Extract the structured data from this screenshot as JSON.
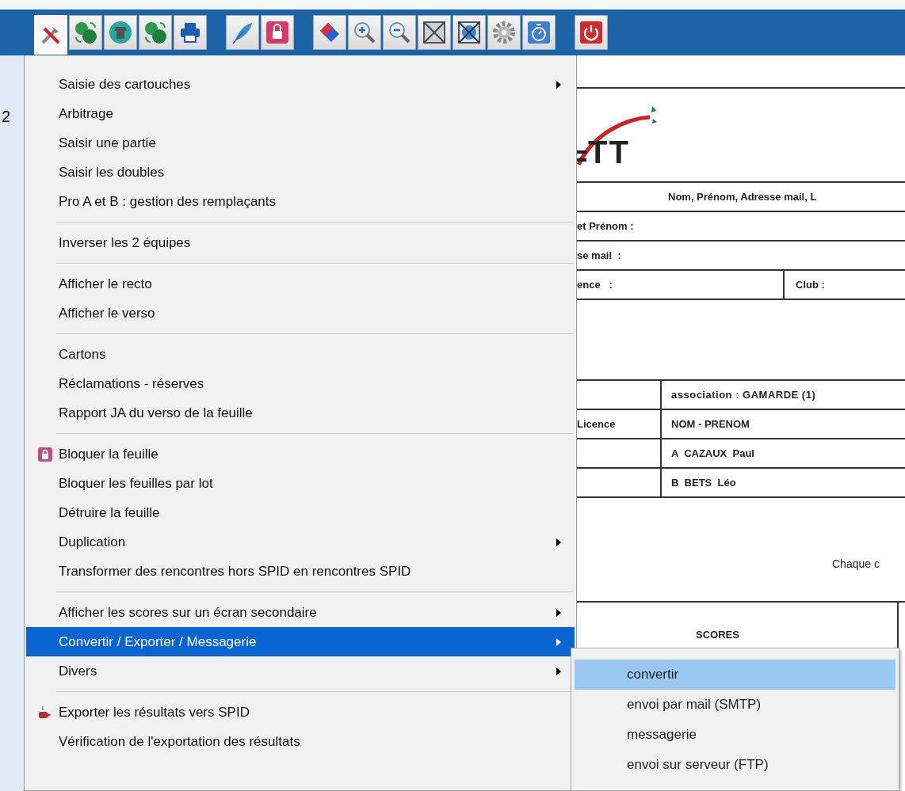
{
  "toolbar": {
    "buttons": [
      {
        "pressed": true
      },
      {
        "pressed": false
      },
      {
        "pressed": false
      },
      {
        "pressed": false
      },
      {
        "pressed": false
      },
      {
        "pressed": false
      },
      {
        "pressed": false
      },
      {
        "pressed": false
      },
      {
        "pressed": false
      },
      {
        "pressed": false
      },
      {
        "pressed": false
      },
      {
        "pressed": false
      },
      {
        "pressed": false
      },
      {
        "pressed": false
      },
      {
        "pressed": false
      }
    ]
  },
  "side_text": "2",
  "menu": {
    "items": [
      {
        "kind": "item",
        "label": "Saisie des cartouches",
        "submenu": true,
        "selected": false
      },
      {
        "kind": "item",
        "label": "Arbitrage",
        "submenu": false,
        "selected": false
      },
      {
        "kind": "item",
        "label": "Saisir une partie",
        "submenu": false,
        "selected": false
      },
      {
        "kind": "item",
        "label": "Saisir les doubles",
        "submenu": false,
        "selected": false
      },
      {
        "kind": "item",
        "label": "Pro A et B : gestion des remplaçants",
        "submenu": false,
        "selected": false
      },
      {
        "kind": "separator"
      },
      {
        "kind": "item",
        "label": "Inverser les 2 équipes",
        "submenu": false,
        "selected": false
      },
      {
        "kind": "separator"
      },
      {
        "kind": "item",
        "label": "Afficher le recto",
        "submenu": false,
        "selected": false
      },
      {
        "kind": "item",
        "label": "Afficher le verso",
        "submenu": false,
        "selected": false
      },
      {
        "kind": "separator"
      },
      {
        "kind": "item",
        "label": "Cartons",
        "submenu": false,
        "selected": false
      },
      {
        "kind": "item",
        "label": "Réclamations - réserves",
        "submenu": false,
        "selected": false
      },
      {
        "kind": "item",
        "label": "Rapport JA du verso de la feuille",
        "submenu": false,
        "selected": false
      },
      {
        "kind": "separator"
      },
      {
        "kind": "lock",
        "label": "Bloquer la feuille",
        "submenu": false,
        "selected": false
      },
      {
        "kind": "item",
        "label": "Bloquer les feuilles par lot",
        "submenu": false,
        "selected": false
      },
      {
        "kind": "item",
        "label": "Détruire la feuille",
        "submenu": false,
        "selected": false
      },
      {
        "kind": "item",
        "label": "Duplication",
        "submenu": true,
        "selected": false
      },
      {
        "kind": "item",
        "label": "Transformer des rencontres hors SPID en rencontres SPID",
        "submenu": false,
        "selected": false
      },
      {
        "kind": "separator"
      },
      {
        "kind": "item",
        "label": "Afficher les scores sur un écran secondaire",
        "submenu": true,
        "selected": false
      },
      {
        "kind": "item",
        "label": "Convertir / Exporter / Messagerie",
        "submenu": true,
        "selected": true
      },
      {
        "kind": "item",
        "label": "Divers",
        "submenu": true,
        "selected": false
      },
      {
        "kind": "separator"
      },
      {
        "kind": "export",
        "label": "Exporter les résultats vers SPID",
        "submenu": false,
        "selected": false
      },
      {
        "kind": "item",
        "label": "Vérification de l'exportation des résultats",
        "submenu": false,
        "selected": false
      }
    ]
  },
  "submenu": {
    "items": [
      {
        "label": "convertir",
        "selected": true
      },
      {
        "label": "envoi par mail (SMTP)",
        "selected": false
      },
      {
        "label": "messagerie",
        "selected": false
      },
      {
        "label": "envoi sur serveur (FTP)",
        "selected": false
      }
    ]
  },
  "document": {
    "logo_text": "TT",
    "header": "Nom, Prénom, Adresse mail, L",
    "fields": [
      "et Prénom :",
      "se mail  :"
    ],
    "licence_label": "ence   :",
    "club_label": "Club :",
    "team_header": "association : GAMARDE (1)",
    "team_rows": [
      {
        "left": "Licence",
        "right": "NOM - PRENOM"
      },
      {
        "right": "A  CAZAUX  Paul"
      },
      {
        "right": "B  BETS  Léo"
      }
    ],
    "note": "Chaque c",
    "scores_header": "SCORES"
  }
}
